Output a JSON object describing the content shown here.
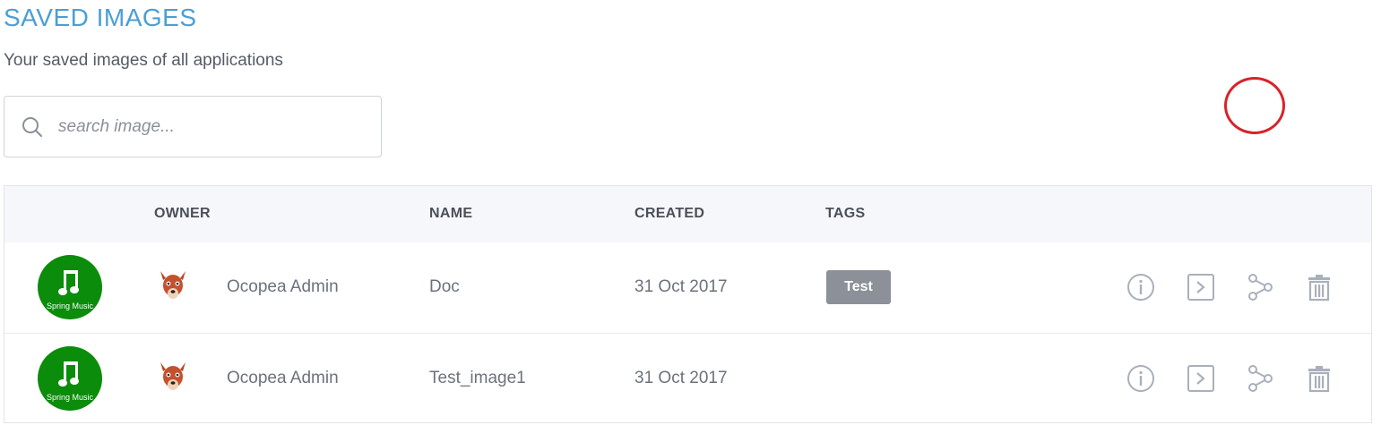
{
  "header": {
    "title": "SAVED IMAGES",
    "subtitle": "Your saved images of all applications"
  },
  "search": {
    "placeholder": "search image...",
    "value": ""
  },
  "table": {
    "columns": [
      "OWNER",
      "NAME",
      "CREATED",
      "TAGS"
    ],
    "rows": [
      {
        "app_label": "Spring Music",
        "owner": "Ocopea Admin",
        "name": "Doc",
        "created": "31 Oct 2017",
        "tag": "Test",
        "actions": [
          "info-icon",
          "terminal-icon",
          "share-icon",
          "trash-icon"
        ]
      },
      {
        "app_label": "Spring Music",
        "owner": "Ocopea Admin",
        "name": "Test_image1",
        "created": "31 Oct 2017",
        "tag": "",
        "actions": [
          "info-icon",
          "terminal-icon",
          "share-icon",
          "trash-icon"
        ]
      }
    ]
  },
  "colors": {
    "title": "#4a9fd5",
    "app_avatar": "#0b8c0b",
    "tag_bg": "#8b9099",
    "icon": "#a9b0bb",
    "highlight_circle": "#d8232a"
  }
}
